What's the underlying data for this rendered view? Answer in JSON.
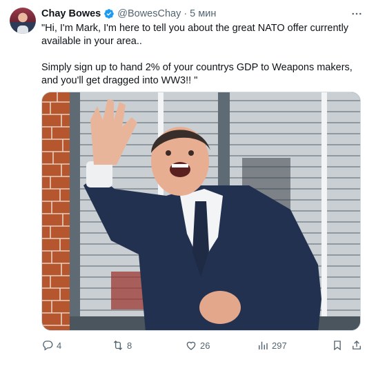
{
  "tweet": {
    "author_name": "Chay Bowes",
    "handle": "@BowesChay",
    "separator": "·",
    "time": "5 мин",
    "text": "\"Hi, I'm Mark, I'm here to tell you about the great NATO offer currently available in your area..\n\nSimply sign up to hand 2% of your countrys GDP to Weapons makers, and you'll get dragged into WW3!! \"",
    "colors": {
      "verified": "#1d9bf0",
      "muted": "#536471",
      "text": "#0f1419"
    }
  },
  "actions": {
    "replies": "4",
    "reposts": "8",
    "likes": "26",
    "views": "297"
  },
  "icons": [
    "verified-badge-icon",
    "more-icon",
    "reply-icon",
    "repost-icon",
    "like-icon",
    "views-icon",
    "bookmark-icon",
    "share-icon"
  ]
}
